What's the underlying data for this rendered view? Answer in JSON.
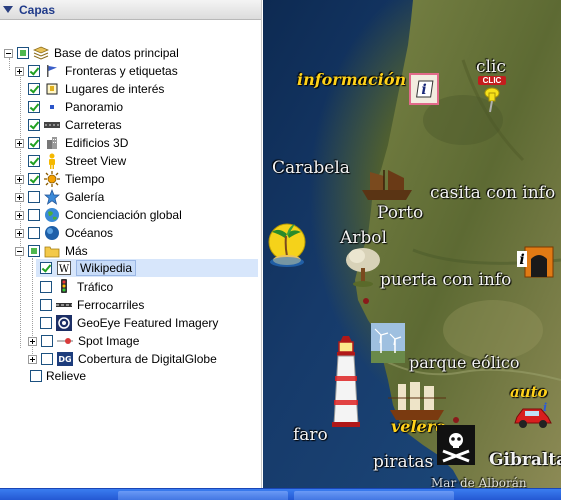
{
  "panel": {
    "title": "Capas",
    "root": "Base de datos principal",
    "items": [
      {
        "label": "Fronteras y etiquetas",
        "icon": "flag-icon",
        "checked": true
      },
      {
        "label": "Lugares de interés",
        "icon": "place-icon",
        "checked": true
      },
      {
        "label": "Panoramio",
        "icon": "panoramio-icon",
        "checked": true
      },
      {
        "label": "Carreteras",
        "icon": "road-icon",
        "checked": true
      },
      {
        "label": "Edificios 3D",
        "icon": "building-icon",
        "checked": true
      },
      {
        "label": "Street View",
        "icon": "pegman-icon",
        "checked": true
      },
      {
        "label": "Tiempo",
        "icon": "sun-icon",
        "checked": true
      },
      {
        "label": "Galería",
        "icon": "star-icon",
        "checked": false
      },
      {
        "label": "Concienciación global",
        "icon": "globe-icon",
        "checked": false
      },
      {
        "label": "Océanos",
        "icon": "ocean-icon",
        "checked": false
      },
      {
        "label": "Más",
        "icon": "folder-icon",
        "checked": "partial"
      }
    ],
    "mas_children": [
      {
        "label": "Wikipedia",
        "icon": "wikipedia-icon",
        "checked": true
      },
      {
        "label": "Tráfico",
        "icon": "traffic-light-icon",
        "checked": false
      },
      {
        "label": "Ferrocarriles",
        "icon": "railway-icon",
        "checked": false
      },
      {
        "label": "GeoEye Featured Imagery",
        "icon": "geoeye-icon",
        "checked": false
      },
      {
        "label": "Spot Image",
        "icon": "spot-image-icon",
        "checked": false
      },
      {
        "label": "Cobertura de DigitalGlobe",
        "icon": "digitalglobe-icon",
        "checked": false
      }
    ],
    "relieve": "Relieve"
  },
  "map": {
    "labels": {
      "informacion": "información",
      "clic": "clic",
      "clic_badge": "CLIC",
      "carabela": "Carabela",
      "casita": "casita con info",
      "porto": "Porto",
      "arbol": "Arbol",
      "puerta": "puerta con info",
      "parque": "parque eólico",
      "auto": "auto",
      "velero": "velero",
      "faro": "faro",
      "piratas": "piratas",
      "gibraltar": "Gibralta",
      "mar": "Mar de Alborán"
    }
  }
}
